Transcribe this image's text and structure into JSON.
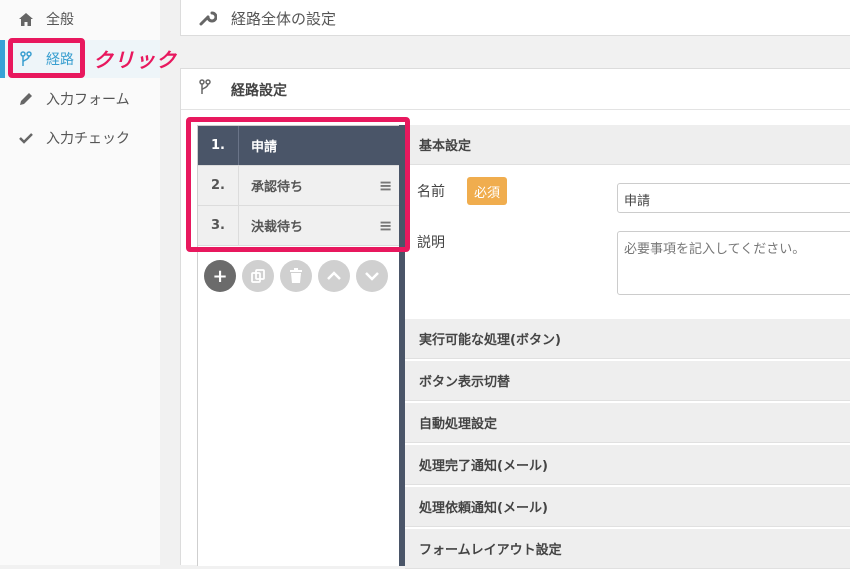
{
  "sidebar": {
    "items": [
      {
        "label": "全般",
        "icon": "home-icon"
      },
      {
        "label": "経路",
        "icon": "route-icon",
        "active": true
      },
      {
        "label": "入力フォーム",
        "icon": "pencil-icon"
      },
      {
        "label": "入力チェック",
        "icon": "check-icon"
      }
    ]
  },
  "annotation": {
    "click_label": "クリック",
    "color": "#e8185e"
  },
  "panel1": {
    "title": "経路全体の設定",
    "icon": "wrench-icon"
  },
  "panel2": {
    "title": "経路設定",
    "icon": "route-icon"
  },
  "steps": [
    {
      "num": "1.",
      "name": "申請",
      "active": true
    },
    {
      "num": "2.",
      "name": "承認待ち"
    },
    {
      "num": "3.",
      "name": "決裁待ち"
    }
  ],
  "tools": [
    "add-icon",
    "copy-icon",
    "trash-icon",
    "up-icon",
    "down-icon"
  ],
  "detail": {
    "basic_header": "基本設定",
    "name_label": "名前",
    "required_badge": "必須",
    "name_value": "申請",
    "desc_label": "説明",
    "desc_placeholder": "必要事項を記入してください。",
    "sections": [
      "実行可能な処理(ボタン)",
      "ボタン表示切替",
      "自動処理設定",
      "処理完了通知(メール)",
      "処理依頼通知(メール)",
      "フォームレイアウト設定"
    ]
  },
  "colors": {
    "accent": "#37a2d6",
    "step_active": "#4a5568",
    "badge": "#f0ad4e"
  }
}
